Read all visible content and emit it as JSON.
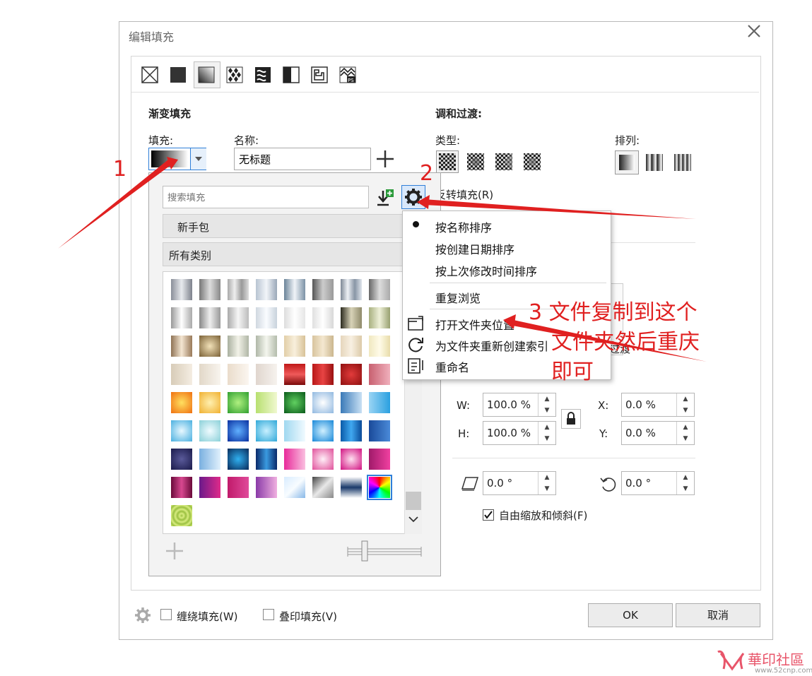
{
  "dialog": {
    "title": "编辑填充",
    "close_label": "✕"
  },
  "gradient_section": {
    "heading": "渐变填充",
    "fill_label": "填充:",
    "name_label": "名称:",
    "name_value": "无标题",
    "add_symbol": "+"
  },
  "blend_section": {
    "heading": "调和过渡:",
    "type_label": "类型:",
    "arrange_label": "排列:",
    "reverse_label": "反转填充(R)",
    "partial_text": "过渡"
  },
  "popup": {
    "search_placeholder": "搜索填充",
    "pack_label": "新手包",
    "category_label": "所有类别"
  },
  "sort_menu": {
    "items": [
      {
        "label": "按名称排序",
        "checked": true
      },
      {
        "label": "按创建日期排序"
      },
      {
        "label": "按上次修改时间排序"
      },
      {
        "label": "重复浏览"
      },
      {
        "label": "打开文件夹位置"
      },
      {
        "label": "为文件夹重新创建索引"
      },
      {
        "label": "重命名"
      }
    ]
  },
  "transform": {
    "w_label": "W:",
    "h_label": "H:",
    "x_label": "X:",
    "y_label": "Y:",
    "w_value": "100.0 %",
    "h_value": "100.0 %",
    "x_value": "0.0 %",
    "y_value": "0.0 %",
    "skew_value": "0.0 °",
    "rotate_value": "0.0 °",
    "free_scale_label": "自由缩放和倾斜(F)",
    "free_scale_checked": true
  },
  "footer": {
    "wrap_fill_label": "缠绕填充(W)",
    "overprint_label": "叠印填充(V)",
    "ok_label": "OK",
    "cancel_label": "取消"
  },
  "annotations": {
    "a1": "1",
    "a2": "2",
    "a3_line1": "3  文件复制到这个",
    "a3_line2": "文件夹然后重庆",
    "a3_line3": "即可"
  },
  "watermark": {
    "name": "華印社區",
    "url": "www.52cnp.com"
  },
  "colors": {
    "annotation_red": "#e02020",
    "accent_blue": "#2f7fd8"
  }
}
